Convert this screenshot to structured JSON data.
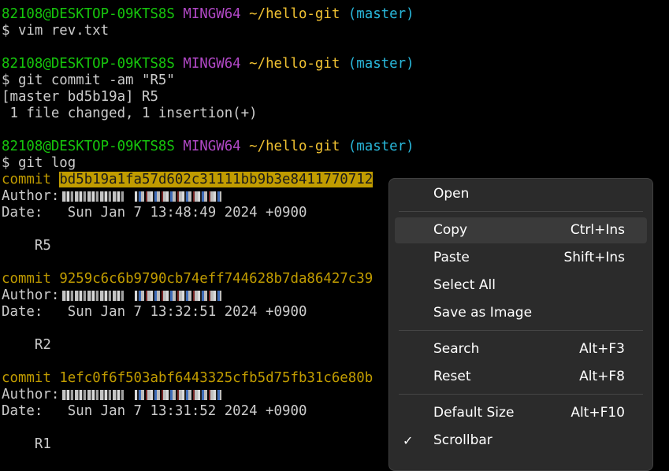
{
  "terminal": {
    "lines": [
      {
        "user": "82108@DESKTOP-09KTS8S",
        "env": "MINGW64",
        "path": "~/hello-git",
        "branch": "(master)"
      },
      {
        "cmd": "$ vim rev.txt"
      },
      {
        "user": "82108@DESKTOP-09KTS8S",
        "env": "MINGW64",
        "path": "~/hello-git",
        "branch": "(master)"
      },
      {
        "cmd": "$ git commit -am \"R5\""
      },
      {
        "out": "[master bd5b19a] R5"
      },
      {
        "out": " 1 file changed, 1 insertion(+)"
      },
      {
        "user": "82108@DESKTOP-09KTS8S",
        "env": "MINGW64",
        "path": "~/hello-git",
        "branch": "(master)"
      },
      {
        "cmd": "$ git log"
      }
    ],
    "commits": [
      {
        "word": "commit",
        "hash": "bd5b19a1fa57d602c31111bb9b3e8411770712",
        "author_label": "Author:",
        "date_label": "Date:",
        "date": "Sun Jan 7 13:48:49 2024 +0900",
        "message": "R5"
      },
      {
        "word": "commit",
        "hash": "9259c6c6b9790cb74eff744628b7da86427c39",
        "author_label": "Author:",
        "date_label": "Date:",
        "date": "Sun Jan 7 13:32:51 2024 +0900",
        "message": "R2"
      },
      {
        "word": "commit",
        "hash": "1efc0f6f503abf6443325cfb5d75fb31c6e80b",
        "author_label": "Author:",
        "date_label": "Date:",
        "date": "Sun Jan 7 13:31:52 2024 +0900",
        "message": "R1"
      }
    ],
    "colors": {
      "user": "#16c60c",
      "env": "#b148c6",
      "path": "#f1c232",
      "branch": "#29b8db",
      "hash": "#c19c00",
      "background": "#000000"
    }
  },
  "context_menu": {
    "items": [
      {
        "label": "Open",
        "shortcut": ""
      },
      {
        "label": "Copy",
        "shortcut": "Ctrl+Ins"
      },
      {
        "label": "Paste",
        "shortcut": "Shift+Ins"
      },
      {
        "label": "Select All",
        "shortcut": ""
      },
      {
        "label": "Save as Image",
        "shortcut": ""
      },
      {
        "label": "Search",
        "shortcut": "Alt+F3"
      },
      {
        "label": "Reset",
        "shortcut": "Alt+F8"
      },
      {
        "label": "Default Size",
        "shortcut": "Alt+F10"
      },
      {
        "label": "Scrollbar",
        "shortcut": "",
        "checked": true,
        "check_icon": "checkmark-icon",
        "check_glyph": "✓"
      }
    ]
  }
}
